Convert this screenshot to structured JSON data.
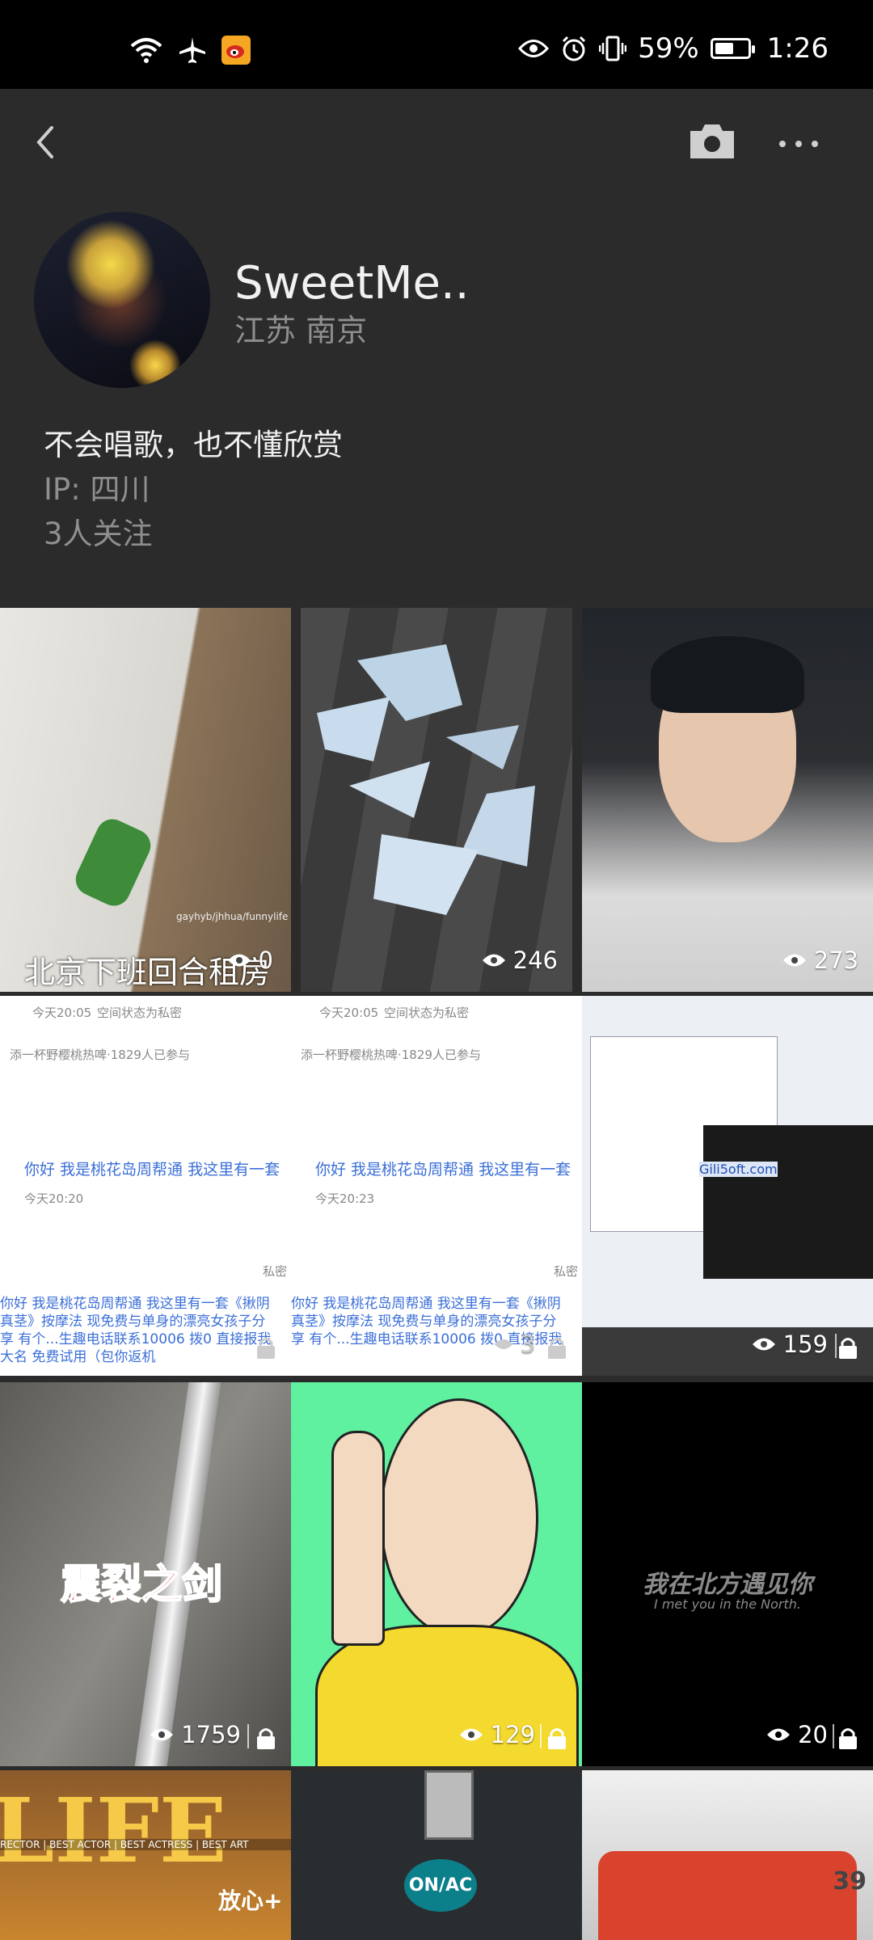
{
  "status_bar": {
    "battery_percent": "59%",
    "battery_level": 0.59,
    "time": "1:26",
    "left_icons": [
      "wifi-icon",
      "airplane-icon",
      "weibo-icon"
    ],
    "right_icons": [
      "eye-icon",
      "alarm-icon",
      "vibrate-icon"
    ]
  },
  "profile": {
    "username": "SweetMe..",
    "location": "江苏 南京",
    "bio": "不会唱歌，也不懂欣赏",
    "ip": "IP: 四川",
    "followers": "3人关注"
  },
  "grid": {
    "items": [
      {
        "caption": "北京下班回合租房",
        "views": "0",
        "locked": false,
        "watermark": "gayhyb/jhhua/funnylife"
      },
      {
        "views": "246",
        "locked": false
      },
      {
        "views": "273",
        "locked": false
      },
      {
        "views": "",
        "locked": true,
        "chat": {
          "time": "今天20:05",
          "status": "空间状态为私密",
          "topic": "添一杯野樱桃热啤·1829人已参与",
          "msg": "你好 我是桃花岛周帮通 我这里有一套",
          "msg_time": "今天20:20",
          "private": "私密",
          "ad": "你好 我是桃花岛周帮通 我这里有一套《揪阴真茎》按摩法 现免费与单身的漂亮女孩子分享 有个...生趣电话联系10006 拨0 直接报我大名 免费试用（包你返机"
        }
      },
      {
        "views": "3",
        "locked": true,
        "chat": {
          "time": "今天20:05",
          "status": "空间状态为私密",
          "topic": "添一杯野樱桃热啤·1829人已参与",
          "msg": "你好 我是桃花岛周帮通 我这里有一套",
          "msg_time": "今天20:23",
          "private": "私密",
          "ad": "你好 我是桃花岛周帮通 我这里有一套《揪阴真茎》按摩法 现免费与单身的漂亮女孩子分享 有个...生趣电话联系10006 拨0 直接报我大名 免费试用（包你返机"
        }
      },
      {
        "views": "159",
        "locked": true,
        "watermark": "Gili5oft.com"
      },
      {
        "caption": "震裂之剑",
        "views": "1759",
        "locked": true
      },
      {
        "views": "129",
        "locked": true
      },
      {
        "caption": "我在北方遇见你",
        "subcaption": "I met you in the North.",
        "views": "20",
        "locked": true
      },
      {
        "caption": "LIFE",
        "subcaption": "放心+",
        "strip": "RECTOR | BEST ACTOR | BEST ACTRESS | BEST ART"
      },
      {
        "caption": "ON/AC"
      },
      {
        "caption": "39"
      }
    ]
  }
}
